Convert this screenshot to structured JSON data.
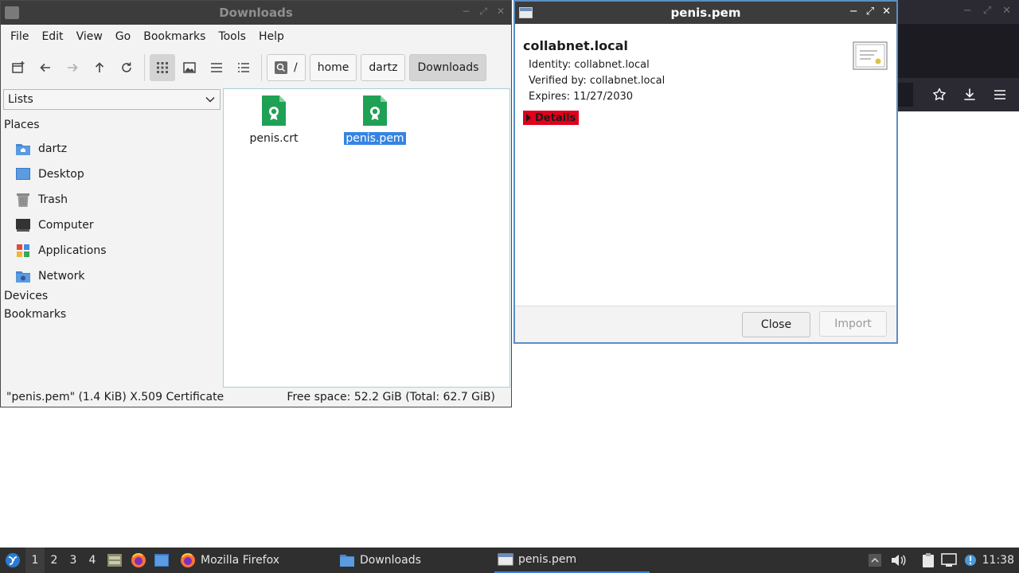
{
  "file_manager": {
    "title": "Downloads",
    "menu": [
      "File",
      "Edit",
      "View",
      "Go",
      "Bookmarks",
      "Tools",
      "Help"
    ],
    "path_root": "/",
    "path": [
      "home",
      "dartz",
      "Downloads"
    ],
    "side_pane_mode": "Lists",
    "places_header": "Places",
    "places": [
      {
        "label": "dartz",
        "icon": "home-folder-icon"
      },
      {
        "label": "Desktop",
        "icon": "desktop-icon"
      },
      {
        "label": "Trash",
        "icon": "trash-icon"
      },
      {
        "label": "Computer",
        "icon": "computer-icon"
      },
      {
        "label": "Applications",
        "icon": "applications-icon"
      },
      {
        "label": "Network",
        "icon": "network-icon"
      }
    ],
    "devices_header": "Devices",
    "bookmarks_header": "Bookmarks",
    "files": [
      {
        "name": "penis.crt",
        "icon": "certificate-file-icon",
        "selected": false
      },
      {
        "name": "penis.pem",
        "icon": "certificate-file-icon",
        "selected": true
      }
    ],
    "status_left": "\"penis.pem\" (1.4 KiB) X.509 Certificate",
    "status_right": "Free space: 52.2 GiB (Total: 62.7 GiB)"
  },
  "cert_dialog": {
    "title": "penis.pem",
    "name": "collabnet.local",
    "identity": "Identity: collabnet.local",
    "verified_by": "Verified by: collabnet.local",
    "expires": "Expires: 11/27/2030",
    "details_label": "Details",
    "close_label": "Close",
    "import_label": "Import"
  },
  "taskbar": {
    "workspaces": [
      "1",
      "2",
      "3",
      "4"
    ],
    "active_workspace": "1",
    "tasks": [
      {
        "label": "Mozilla Firefox",
        "icon": "firefox-icon"
      },
      {
        "label": "Downloads",
        "icon": "folder-icon"
      },
      {
        "label": "penis.pem",
        "icon": "window-icon",
        "active": true
      }
    ],
    "clock": "11:38"
  },
  "colors": {
    "selection": "#3584e4",
    "details_highlight": "#e2001a",
    "file_icon_green": "#1fa155",
    "taskbar_bg": "#2f2f2f"
  }
}
